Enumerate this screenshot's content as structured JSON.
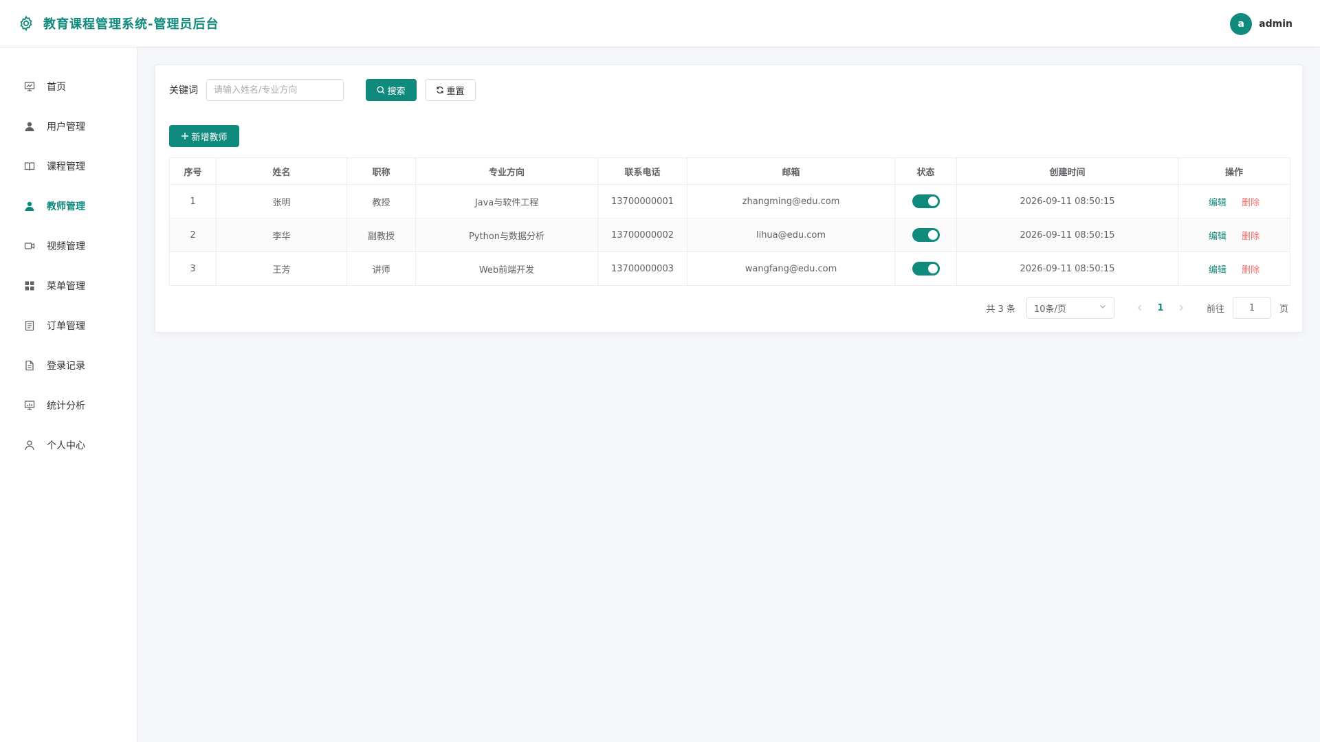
{
  "header": {
    "title": "教育课程管理系统-管理员后台",
    "user_initial": "a",
    "user_name": "admin"
  },
  "colors": {
    "accent": "#0f8a7d",
    "danger": "#f56c6c",
    "background": "#f5f7fa"
  },
  "sidebar": {
    "items": [
      {
        "label": "首页",
        "icon": "chart-board-icon",
        "active": false
      },
      {
        "label": "用户管理",
        "icon": "user-icon",
        "active": false
      },
      {
        "label": "课程管理",
        "icon": "book-icon",
        "active": false
      },
      {
        "label": "教师管理",
        "icon": "user-icon",
        "active": true
      },
      {
        "label": "视频管理",
        "icon": "video-camera-icon",
        "active": false
      },
      {
        "label": "菜单管理",
        "icon": "grid-icon",
        "active": false
      },
      {
        "label": "订单管理",
        "icon": "document-list-icon",
        "active": false
      },
      {
        "label": "登录记录",
        "icon": "document-icon",
        "active": false
      },
      {
        "label": "统计分析",
        "icon": "chart-board-icon",
        "active": false
      },
      {
        "label": "个人中心",
        "icon": "user-outline-icon",
        "active": false
      }
    ]
  },
  "search": {
    "label": "关键词",
    "placeholder": "请输入姓名/专业方向",
    "value": "",
    "search_label": "搜索",
    "reset_label": "重置"
  },
  "toolbar": {
    "add_label": "新增教师"
  },
  "table": {
    "columns": [
      "序号",
      "姓名",
      "职称",
      "专业方向",
      "联系电话",
      "邮箱",
      "状态",
      "创建时间",
      "操作"
    ],
    "rows": [
      {
        "index": "1",
        "name": "张明",
        "title": "教授",
        "major": "Java与软件工程",
        "phone": "13700000001",
        "email": "zhangming@edu.com",
        "status": true,
        "created": "2026-09-11 08:50:15"
      },
      {
        "index": "2",
        "name": "李华",
        "title": "副教授",
        "major": "Python与数据分析",
        "phone": "13700000002",
        "email": "lihua@edu.com",
        "status": true,
        "created": "2026-09-11 08:50:15"
      },
      {
        "index": "3",
        "name": "王芳",
        "title": "讲师",
        "major": "Web前端开发",
        "phone": "13700000003",
        "email": "wangfang@edu.com",
        "status": true,
        "created": "2026-09-11 08:50:15"
      }
    ],
    "edit_label": "编辑",
    "delete_label": "删除"
  },
  "pagination": {
    "total_text": "共 3 条",
    "page_size": "10条/页",
    "current_page": "1",
    "goto_label": "前往",
    "goto_value": "1",
    "page_unit": "页"
  }
}
